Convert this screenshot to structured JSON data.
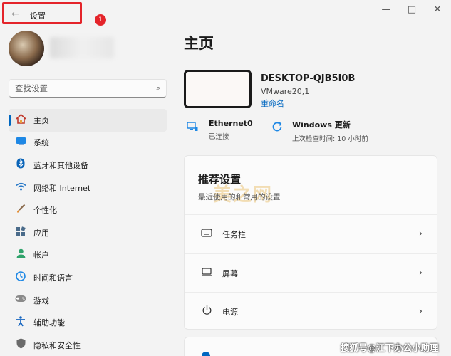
{
  "titlebar": {
    "back_icon": "←",
    "title": "设置",
    "badge": "1",
    "minimize": "—",
    "maximize": "□",
    "close": "✕"
  },
  "search": {
    "placeholder": "查找设置",
    "icon": "⌕"
  },
  "nav": [
    {
      "label": "主页",
      "icon": "home-icon",
      "color": "#c0392b",
      "active": true
    },
    {
      "label": "系统",
      "icon": "system-icon",
      "color": "#1e88e5",
      "active": false
    },
    {
      "label": "蓝牙和其他设备",
      "icon": "bluetooth-icon",
      "color": "#0a64b8",
      "active": false
    },
    {
      "label": "网络和 Internet",
      "icon": "wifi-icon",
      "color": "#2a7ac8",
      "active": false
    },
    {
      "label": "个性化",
      "icon": "brush-icon",
      "color": "#e38b2e",
      "active": false
    },
    {
      "label": "应用",
      "icon": "apps-icon",
      "color": "#4a6b8a",
      "active": false
    },
    {
      "label": "帐户",
      "icon": "account-icon",
      "color": "#2fa36b",
      "active": false
    },
    {
      "label": "时间和语言",
      "icon": "clock-globe-icon",
      "color": "#1e88e5",
      "active": false
    },
    {
      "label": "游戏",
      "icon": "gamepad-icon",
      "color": "#6b6b6b",
      "active": false
    },
    {
      "label": "辅助功能",
      "icon": "accessibility-icon",
      "color": "#1565c0",
      "active": false
    },
    {
      "label": "隐私和安全性",
      "icon": "shield-icon",
      "color": "#555555",
      "active": false
    }
  ],
  "main": {
    "title": "主页",
    "device": {
      "name": "DESKTOP-QJB5I0B",
      "model": "VMware20,1",
      "rename": "重命名"
    },
    "status": [
      {
        "title": "Ethernet0",
        "sub": "已连接",
        "icon": "ethernet-icon"
      },
      {
        "title": "Windows 更新",
        "sub": "上次检查时间: 10 小时前",
        "icon": "update-icon"
      }
    ],
    "recommended": {
      "title": "推荐设置",
      "subtitle": "最近使用的和常用的设置",
      "watermark": "美之网",
      "items": [
        {
          "label": "任务栏",
          "icon": "taskbar-icon"
        },
        {
          "label": "屏幕",
          "icon": "display-icon"
        },
        {
          "label": "电源",
          "icon": "power-icon"
        }
      ]
    }
  },
  "footer": {
    "credit": "搜狐号@江下办公小助理"
  },
  "colors": {
    "accent": "#0067c0",
    "highlight_red": "#e4242a"
  }
}
